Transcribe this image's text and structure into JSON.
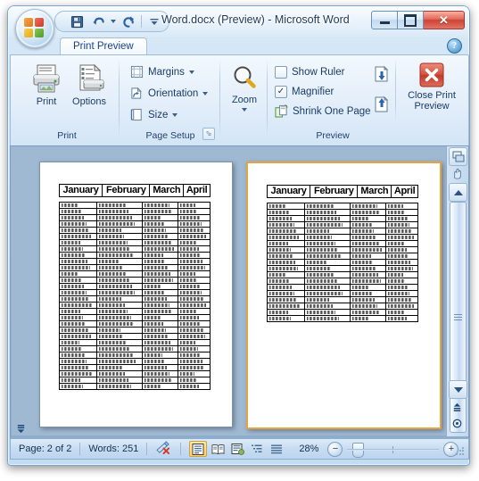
{
  "window": {
    "title": "Word.docx (Preview) - Microsoft Word",
    "controls": {
      "minimize": "Minimize",
      "maximize": "Restore",
      "close": "Close"
    }
  },
  "quick_access": {
    "items": [
      {
        "name": "save",
        "label": "Save",
        "icon": "save-icon"
      },
      {
        "name": "undo",
        "label": "Undo",
        "icon": "undo-icon"
      },
      {
        "name": "redo",
        "label": "Redo",
        "icon": "redo-icon"
      },
      {
        "name": "customize",
        "label": "Customize Quick Access Toolbar",
        "icon": "chevron-down-icon"
      }
    ]
  },
  "ribbon": {
    "tabs": [
      {
        "label": "Print Preview",
        "selected": true
      }
    ],
    "help": {
      "label": "?",
      "title": "Microsoft Office Word Help"
    },
    "groups": [
      {
        "name": "print",
        "label": "Print",
        "buttons": [
          {
            "label": "Print",
            "icon": "printer-icon"
          },
          {
            "label": "Options",
            "icon": "options-icon"
          }
        ]
      },
      {
        "name": "page-setup",
        "label": "Page Setup",
        "has_dialog_launcher": true,
        "buttons": [
          {
            "label": "Margins",
            "icon": "margins-icon",
            "dropdown": true
          },
          {
            "label": "Orientation",
            "icon": "orientation-icon",
            "dropdown": true
          },
          {
            "label": "Size",
            "icon": "size-icon",
            "dropdown": true
          }
        ]
      },
      {
        "name": "zoom",
        "label": "",
        "buttons": [
          {
            "label": "Zoom",
            "icon": "magnifier-icon",
            "dropdown": true
          }
        ]
      },
      {
        "name": "preview",
        "label": "Preview",
        "checkboxes": [
          {
            "label": "Show Ruler",
            "checked": false
          },
          {
            "label": "Magnifier",
            "checked": true
          }
        ],
        "buttons": [
          {
            "label": "Shrink One Page",
            "icon": "shrink-one-page-icon"
          },
          {
            "label": "Next Page",
            "icon": "next-page-icon"
          },
          {
            "label": "Previous Page",
            "icon": "previous-page-icon"
          },
          {
            "label": "Close Print\nPreview",
            "icon": "close-red-x-icon"
          }
        ],
        "close_button_line1": "Close Print",
        "close_button_line2": "Preview"
      }
    ]
  },
  "document": {
    "pages": [
      {
        "name": "page-1",
        "selected": false,
        "table": {
          "headers": [
            "January",
            "February",
            "March",
            "April"
          ],
          "row_count": 30
        }
      },
      {
        "name": "page-2",
        "selected": true,
        "table": {
          "headers": [
            "January",
            "February",
            "March",
            "April"
          ],
          "row_count": 19
        }
      }
    ],
    "scrollbar": {
      "split_label": "Split window",
      "hand_label": "Pan",
      "up_label": "Scroll up",
      "down_label": "Scroll down",
      "previous_page_label": "Previous Page",
      "browse_object_label": "Select Browse Object",
      "next_page_label": "Next Page"
    }
  },
  "status_bar": {
    "page_text": "Page: 2 of 2",
    "words_text": "Words: 251",
    "proofing_icon_label": "Proofing errors",
    "views": [
      {
        "name": "print-layout",
        "label": "Print Layout",
        "active": true
      },
      {
        "name": "full-screen-reading",
        "label": "Full Screen Reading",
        "active": false
      },
      {
        "name": "web-layout",
        "label": "Web Layout",
        "active": false
      },
      {
        "name": "outline",
        "label": "Outline",
        "active": false
      },
      {
        "name": "draft",
        "label": "Draft",
        "active": false
      }
    ],
    "zoom_text": "28%",
    "zoom_out_label": "−",
    "zoom_in_label": "+"
  },
  "colors": {
    "accent": "#15428b",
    "selection_orange": "#e8a33d",
    "close_red": "#cf4233",
    "ribbon_bg": "#e3eefa"
  }
}
